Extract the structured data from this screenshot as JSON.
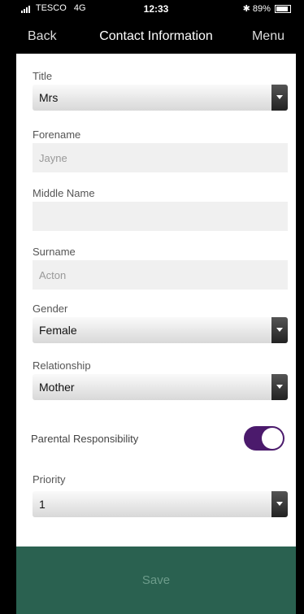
{
  "status_bar": {
    "carrier": "TESCO",
    "network": "4G",
    "time": "12:33",
    "battery": "89%"
  },
  "nav": {
    "back_label": "Back",
    "title": "Contact Information",
    "menu_label": "Menu"
  },
  "form": {
    "title": {
      "label": "Title",
      "value": "Mrs"
    },
    "forename": {
      "label": "Forename",
      "value": "Jayne"
    },
    "middle_name": {
      "label": "Middle Name",
      "value": ""
    },
    "surname": {
      "label": "Surname",
      "value": "Acton"
    },
    "gender": {
      "label": "Gender",
      "value": "Female"
    },
    "relationship": {
      "label": "Relationship",
      "value": "Mother"
    },
    "parental_responsibility": {
      "label": "Parental Responsibility",
      "on": true
    },
    "priority": {
      "label": "Priority",
      "value": "1"
    }
  },
  "save_label": "Save",
  "colors": {
    "toggle_on": "#4b1a6c",
    "save_bar": "#2a6150",
    "save_text": "#6c9b8a"
  }
}
